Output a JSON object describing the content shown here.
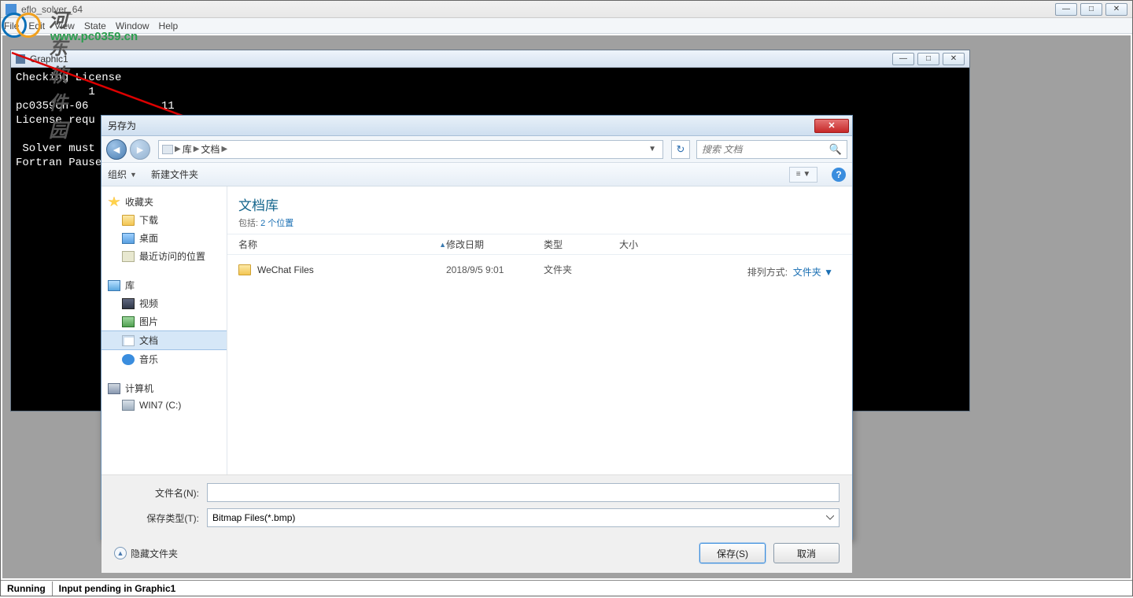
{
  "main_window": {
    "title": "eflo_solver_64",
    "menu": [
      "File",
      "Edit",
      "View",
      "State",
      "Window",
      "Help"
    ]
  },
  "graphic_window": {
    "title": "Graphic1",
    "console_lines": "Checking License\n           1\npc0359cn-06           11\nLicense requ\n\n Solver must \nFortran Pause"
  },
  "watermark": {
    "title": "河东软件园",
    "url": "www.pc0359.cn"
  },
  "dialog": {
    "title": "另存为",
    "breadcrumb": {
      "root": "库",
      "current": "文档"
    },
    "search_placeholder": "搜索 文档",
    "toolbar": {
      "organize": "组织",
      "new_folder": "新建文件夹"
    },
    "sidebar": {
      "favorites": "收藏夹",
      "fav_items": [
        "下载",
        "桌面",
        "最近访问的位置"
      ],
      "libraries": "库",
      "lib_items": [
        "视频",
        "图片",
        "文档",
        "音乐"
      ],
      "computer": "计算机",
      "drives": [
        "WIN7 (C:)"
      ]
    },
    "library_header": {
      "title": "文档库",
      "sub_prefix": "包括: ",
      "sub_link": "2 个位置"
    },
    "arrange": {
      "label": "排列方式:",
      "value": "文件夹"
    },
    "columns": {
      "name": "名称",
      "date": "修改日期",
      "type": "类型",
      "size": "大小"
    },
    "rows": [
      {
        "name": "WeChat Files",
        "date": "2018/9/5 9:01",
        "type": "文件夹",
        "size": ""
      }
    ],
    "fields": {
      "filename_label": "文件名(N):",
      "filename_value": "",
      "filetype_label": "保存类型(T):",
      "filetype_value": "Bitmap Files(*.bmp)"
    },
    "footer": {
      "hide": "隐藏文件夹",
      "save": "保存(S)",
      "cancel": "取消"
    }
  },
  "statusbar": {
    "running": "Running",
    "pending": "Input pending in Graphic1"
  }
}
